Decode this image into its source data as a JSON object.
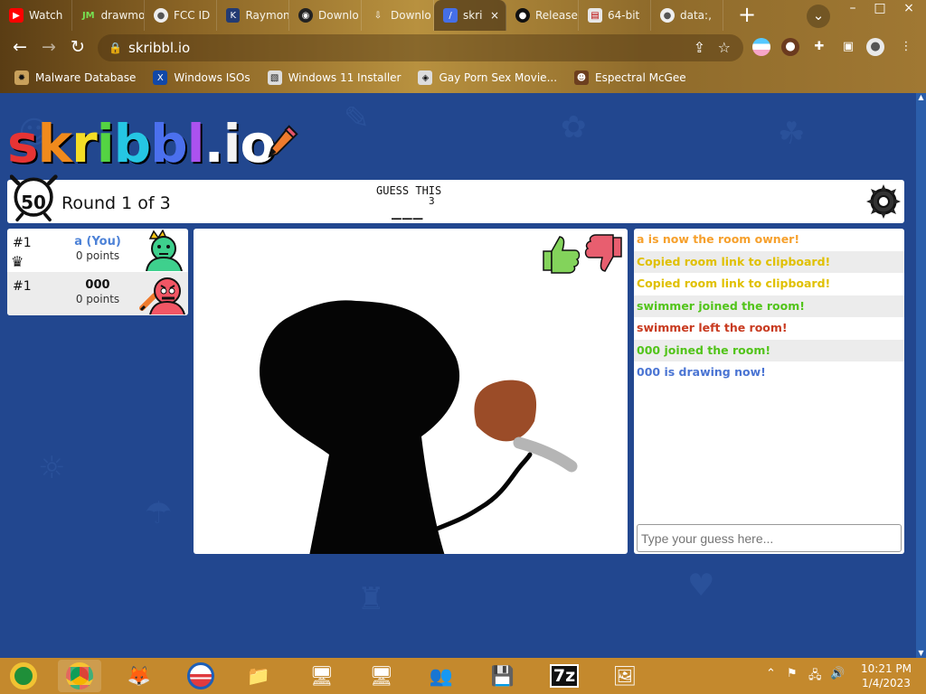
{
  "browser": {
    "tabs": [
      {
        "icon": "youtube-icon",
        "label": "Watch",
        "active": false
      },
      {
        "icon": "drawmo-icon",
        "label": "drawmo",
        "active": false
      },
      {
        "icon": "globe-icon",
        "label": "FCC ID",
        "active": false
      },
      {
        "icon": "raymon-icon",
        "label": "Raymon",
        "active": false
      },
      {
        "icon": "download-icon",
        "label": "Downlo",
        "active": false
      },
      {
        "icon": "download-arrow-icon",
        "label": "Downlo",
        "active": false
      },
      {
        "icon": "skribbl-icon",
        "label": "skri",
        "active": true
      },
      {
        "icon": "github-icon",
        "label": "Release",
        "active": false
      },
      {
        "icon": "document-icon",
        "label": "64-bit",
        "active": false
      },
      {
        "icon": "globe-icon",
        "label": "data:,",
        "active": false
      }
    ],
    "url": "skribbl.io",
    "bookmarks": [
      {
        "icon": "virus-icon",
        "label": "Malware Database"
      },
      {
        "icon": "x-icon",
        "label": "Windows ISOs"
      },
      {
        "icon": "image-icon",
        "label": "Windows 11 Installer"
      },
      {
        "icon": "link-icon",
        "label": "Gay Porn Sex Movie..."
      },
      {
        "icon": "avatar-icon",
        "label": "Espectral McGee"
      }
    ]
  },
  "game": {
    "logo": "skribbl.io!",
    "timer": "50",
    "round": "Round 1 of 3",
    "guess_label": "GUESS THIS",
    "word_length": "3",
    "word_blanks": "___",
    "players": [
      {
        "rank": "#1",
        "name": "a (You)",
        "points": "0 points",
        "is_self": true,
        "is_owner": true
      },
      {
        "rank": "#1",
        "name": "000",
        "points": "0 points",
        "is_self": false,
        "is_drawing": true
      }
    ],
    "chat": [
      {
        "text": "a is now the room owner!",
        "color": "orange"
      },
      {
        "text": "Copied room link to clipboard!",
        "color": "yellow"
      },
      {
        "text": "Copied room link to clipboard!",
        "color": "yellow"
      },
      {
        "text": "swimmer joined the room!",
        "color": "green"
      },
      {
        "text": "swimmer left the room!",
        "color": "red"
      },
      {
        "text": "000 joined the room!",
        "color": "green"
      },
      {
        "text": "000 is drawing now!",
        "color": "blue"
      }
    ],
    "guess_placeholder": "Type your guess here..."
  },
  "taskbar": {
    "apps": [
      {
        "icon": "windows-media-center-icon"
      },
      {
        "icon": "chrome-icon"
      },
      {
        "icon": "firefox-icon"
      },
      {
        "icon": "obama-logo-icon"
      },
      {
        "icon": "file-explorer-icon"
      },
      {
        "icon": "network-setup-icon"
      },
      {
        "icon": "network-setup-icon"
      },
      {
        "icon": "network-users-icon"
      },
      {
        "icon": "disk-cleanup-icon"
      },
      {
        "icon": "7zip-icon",
        "label": "7z"
      },
      {
        "icon": "image-viewer-icon"
      }
    ],
    "time": "10:21 PM",
    "date": "1/4/2023"
  }
}
